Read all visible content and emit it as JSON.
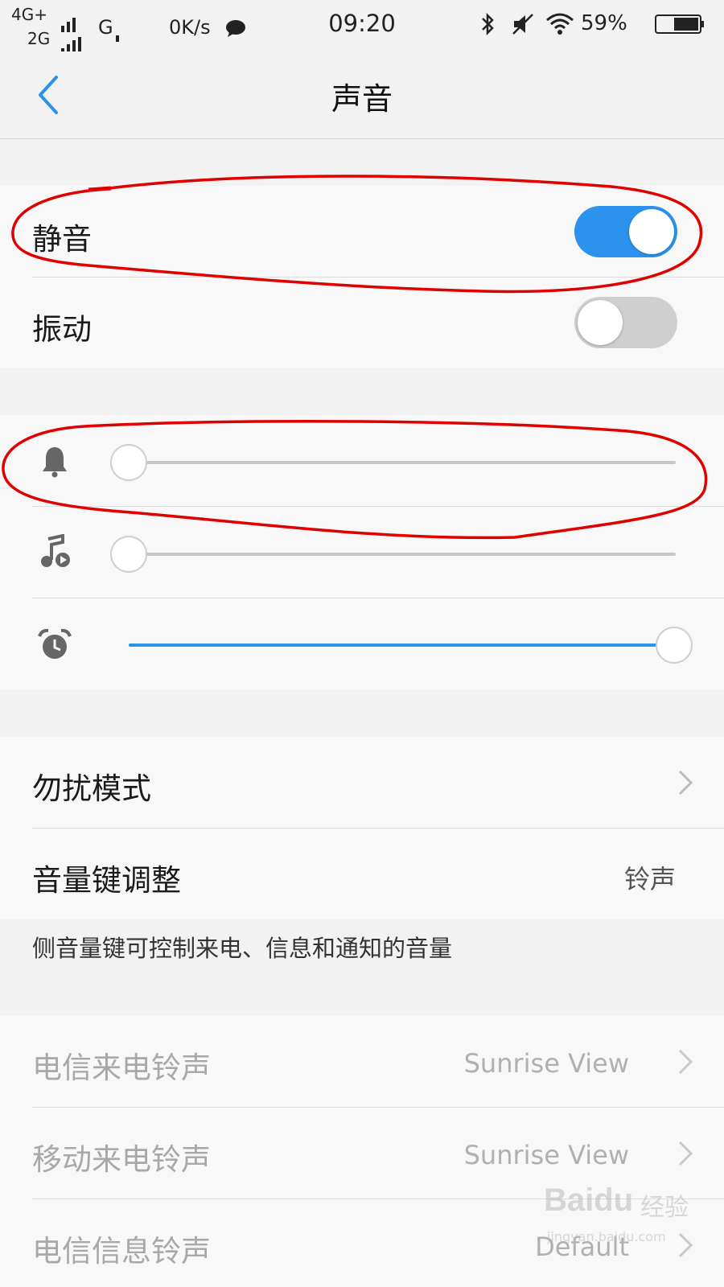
{
  "status_bar": {
    "network_line1": "4G+",
    "network_line2": "2G",
    "network_g": "G",
    "speed": "0K/s",
    "time": "09:20",
    "battery": "59%"
  },
  "header": {
    "title": "声音"
  },
  "toggles": [
    {
      "label": "静音",
      "on": true
    },
    {
      "label": "振动",
      "on": false
    }
  ],
  "volumes": [
    {
      "icon": "bell-icon",
      "level_percent": 0
    },
    {
      "icon": "music-icon",
      "level_percent": 0
    },
    {
      "icon": "alarm-icon",
      "level_percent": 100
    }
  ],
  "settings": {
    "dnd_label": "勿扰模式",
    "volume_key_label": "音量键调整",
    "volume_key_value": "铃声",
    "footnote": "侧音量键可控制来电、信息和通知的音量"
  },
  "ringtones": [
    {
      "label": "电信来电铃声",
      "value": "Sunrise View"
    },
    {
      "label": "移动来电铃声",
      "value": "Sunrise View"
    },
    {
      "label": "电信信息铃声",
      "value": "Default"
    }
  ],
  "watermark": {
    "logo": "Baidu",
    "text": "经验",
    "url": "jingyan.baidu.com"
  },
  "colors": {
    "accent": "#2b93ee",
    "annotation": "#e00000"
  }
}
